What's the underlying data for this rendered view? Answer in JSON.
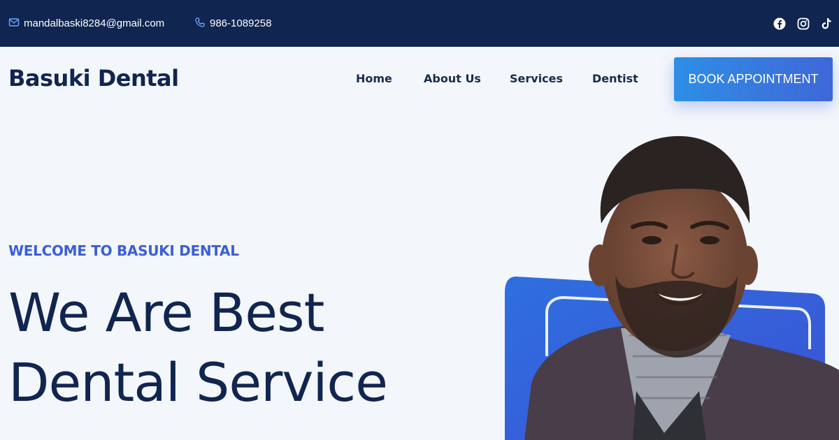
{
  "topbar": {
    "email": "mandalbaski8284@gmail.com",
    "phone": "986-1089258",
    "socials": [
      "facebook-icon",
      "instagram-icon",
      "tiktok-icon"
    ]
  },
  "header": {
    "logo": "Basuki Dental",
    "nav": [
      "Home",
      "About Us",
      "Services",
      "Dentist"
    ],
    "cta": "BOOK APPOINTMENT"
  },
  "hero": {
    "subtitle": "WELCOME TO BASUKI DENTAL",
    "title_line1": "We Are Best",
    "title_line2": "Dental Service"
  },
  "colors": {
    "topbar_bg": "#10254f",
    "accent": "#3b5fd6",
    "cta_start": "#2e8fe6",
    "cta_end": "#3f67d8"
  }
}
